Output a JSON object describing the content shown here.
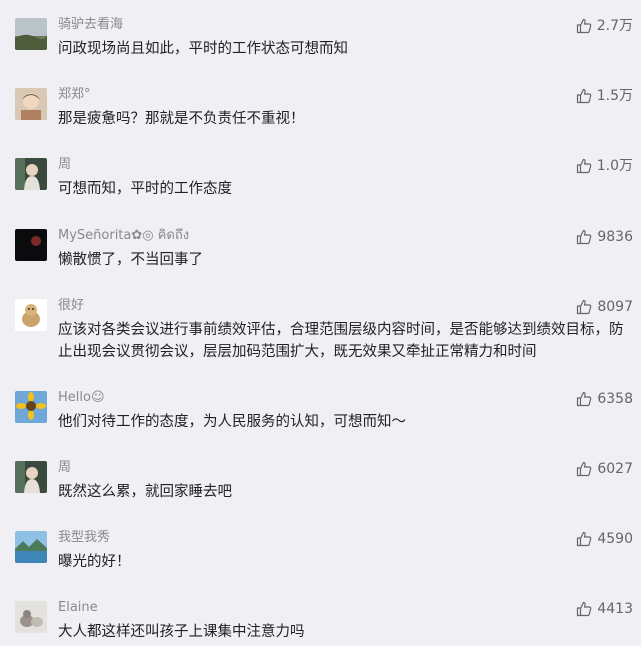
{
  "comments": [
    {
      "name": "骑驴去看海",
      "text": "问政现场尚且如此，平时的工作状态可想而知",
      "likes": "2.7万",
      "avatar": "landscape-avatar"
    },
    {
      "name": "郑郑°",
      "text": "那是疲惫吗？那就是不负责任不重视！",
      "likes": "1.5万",
      "avatar": "child-avatar"
    },
    {
      "name": "周",
      "text": "可想而知，平时的工作态度",
      "likes": "1.0万",
      "avatar": "girl-avatar"
    },
    {
      "name": "MySeñorita✿◎ คิดถึง",
      "text": "懒散惯了，不当回事了",
      "likes": "9836",
      "avatar": "dark-moon-avatar"
    },
    {
      "name": "很好",
      "text": "应该对各类会议进行事前绩效评估，合理范围层级内容时间，是否能够达到绩效目标，防止出现会议贯彻会议，层层加码范围扩大，既无效果又牵扯正常精力和时间",
      "likes": "8097",
      "avatar": "dog-avatar"
    },
    {
      "name": "Hello☺",
      "text": "他们对待工作的态度，为人民服务的认知，可想而知～",
      "likes": "6358",
      "avatar": "sunflower-avatar"
    },
    {
      "name": "周",
      "text": "既然这么累，就回家睡去吧",
      "likes": "6027",
      "avatar": "girl-avatar"
    },
    {
      "name": "我型我秀",
      "text": "曝光的好！",
      "likes": "4590",
      "avatar": "lake-avatar"
    },
    {
      "name": "Elaine",
      "text": "大人都这样还叫孩子上课集中注意力吗",
      "likes": "4413",
      "avatar": "kitten-avatar"
    }
  ]
}
